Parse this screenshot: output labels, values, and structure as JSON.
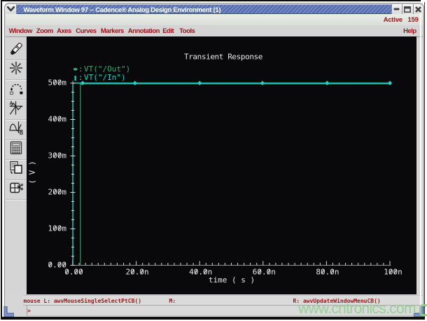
{
  "window": {
    "title": "Waveform Window 97 -- Cadence® Analog Design Environment (1)",
    "controls": {
      "minimize": "minimize",
      "maximize": "maximize",
      "close": "close"
    }
  },
  "header": {
    "active_label": "Active",
    "active_count": "159",
    "help_label": "Help"
  },
  "menu": {
    "items": [
      "Window",
      "Zoom",
      "Axes",
      "Curves",
      "Markers",
      "Annotation",
      "Edit",
      "Tools"
    ]
  },
  "toolbar": {
    "buttons": [
      {
        "icon": "pen-icon"
      },
      {
        "icon": "zoom-fit-icon"
      },
      {
        "icon": "drag-curve-icon"
      },
      {
        "icon": "strip-chart-icon"
      },
      {
        "icon": "composite-axes-icon"
      },
      {
        "icon": "calculator-icon"
      },
      {
        "icon": "copy-window-icon"
      },
      {
        "icon": "delete-subwindow-icon"
      }
    ]
  },
  "status": {
    "mouse_left": "mouse L: awvMouseSingleSelectPtCB()",
    "mouse_middle": "M:",
    "mouse_right": "R: awvUpdateWindowMenuCB()",
    "prompt": ">"
  },
  "watermark": {
    "text": "www.cntronics.com"
  },
  "chart_data": {
    "type": "line",
    "title": "Transient Response",
    "xlabel": "time ( s )",
    "ylabel": "( V )",
    "xlim_ns": [
      0,
      100
    ],
    "ylim_mV": [
      0,
      500
    ],
    "x_tick_step_ns": {
      "minor": 2,
      "major": 20
    },
    "y_tick_step_mV": {
      "minor": 25,
      "major": 100
    },
    "x_tick_labels": [
      "0.00",
      "20.0n",
      "40.0n",
      "60.0n",
      "80.0n",
      "100n"
    ],
    "y_tick_labels": [
      "0.00",
      "100m",
      "200m",
      "300m",
      "400m",
      "500m"
    ],
    "background": "#09090b",
    "text_color": "#e8e8e8",
    "series": [
      {
        "name": "VT(\"/Out\")",
        "color": "#3da876",
        "line_color": "#399d68",
        "step_time_ns": 2.4,
        "low_mV": 0,
        "high_mV": 500,
        "legend_marker": "dash"
      },
      {
        "name": "VT(\"/In\")",
        "color": "#2fccc4",
        "line_color": "#2fccc4",
        "step_time_ns": 0,
        "low_mV": 0,
        "high_mV": 500,
        "legend_marker": "bar",
        "point_markers_ns": [
          3.1,
          19.6,
          40.0,
          59.8,
          80.2,
          100.0
        ]
      }
    ]
  }
}
